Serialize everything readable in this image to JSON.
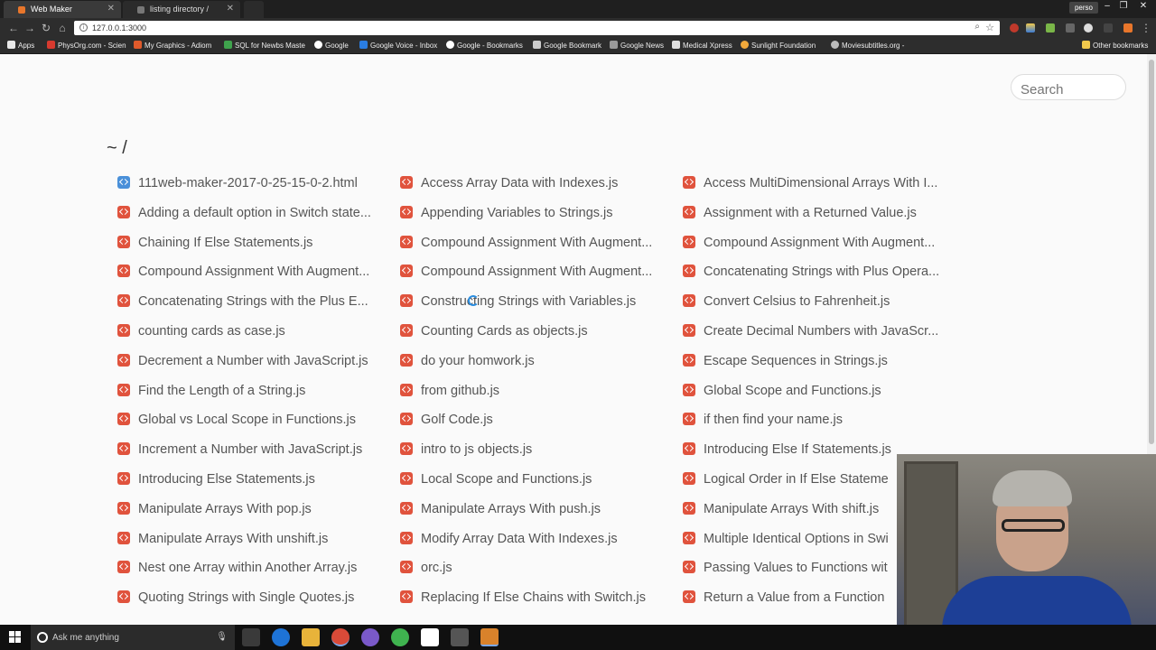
{
  "browser": {
    "tabs": [
      {
        "title": "Web Maker",
        "active": true
      },
      {
        "title": "listing directory /",
        "active": false
      }
    ],
    "profile": "perso",
    "url": "127.0.0.1:3000",
    "bookmarks": [
      {
        "label": "Apps",
        "color": "#e8e8e8"
      },
      {
        "label": "PhysOrg.com - Scien",
        "color": "#d73a2f"
      },
      {
        "label": "My Graphics - Adiom",
        "color": "#e05a2b"
      },
      {
        "label": "SQL for Newbs Maste",
        "color": "#3fa34d"
      },
      {
        "label": "Google",
        "color": "#ffffff"
      },
      {
        "label": "Google Voice - Inbox",
        "color": "#2a7de1"
      },
      {
        "label": "Google - Bookmarks",
        "color": "#ffffff"
      },
      {
        "label": "Google Bookmark",
        "color": "#cccccc"
      },
      {
        "label": "Google News",
        "color": "#9a9a9a"
      },
      {
        "label": "Medical Xpress",
        "color": "#e0e0e0"
      },
      {
        "label": "Sunlight Foundation",
        "color": "#f2a93b"
      },
      {
        "label": "Moviesubtitles.org - ",
        "color": "#bbbbbb"
      }
    ],
    "other_bookmarks": "Other bookmarks"
  },
  "page": {
    "search_placeholder": "Search",
    "path": "~ /",
    "files": [
      {
        "name": "111web-maker-2017-0-25-15-0-2.html",
        "kind": "html"
      },
      {
        "name": "Access Array Data with Indexes.js",
        "kind": "js"
      },
      {
        "name": "Access MultiDimensional Arrays With I...",
        "kind": "js"
      },
      {
        "name": "Adding a default option in Switch state...",
        "kind": "js"
      },
      {
        "name": "Appending Variables to Strings.js",
        "kind": "js"
      },
      {
        "name": "Assignment with a Returned Value.js",
        "kind": "js"
      },
      {
        "name": "Chaining If Else Statements.js",
        "kind": "js"
      },
      {
        "name": "Compound Assignment With Augment...",
        "kind": "js"
      },
      {
        "name": "Compound Assignment With Augment...",
        "kind": "js"
      },
      {
        "name": "Compound Assignment With Augment...",
        "kind": "js"
      },
      {
        "name": "Compound Assignment With Augment...",
        "kind": "js"
      },
      {
        "name": "Concatenating Strings with Plus Opera...",
        "kind": "js"
      },
      {
        "name": "Concatenating Strings with the Plus E...",
        "kind": "js"
      },
      {
        "name": "Constructing Strings with Variables.js",
        "kind": "js"
      },
      {
        "name": "Convert Celsius to Fahrenheit.js",
        "kind": "js"
      },
      {
        "name": "counting cards as case.js",
        "kind": "js"
      },
      {
        "name": "Counting Cards as objects.js",
        "kind": "js"
      },
      {
        "name": "Create Decimal Numbers with JavaScr...",
        "kind": "js"
      },
      {
        "name": "Decrement a Number with JavaScript.js",
        "kind": "js"
      },
      {
        "name": "do your homwork.js",
        "kind": "js"
      },
      {
        "name": "Escape Sequences in Strings.js",
        "kind": "js"
      },
      {
        "name": "Find the Length of a String.js",
        "kind": "js"
      },
      {
        "name": "from github.js",
        "kind": "js"
      },
      {
        "name": "Global Scope and Functions.js",
        "kind": "js"
      },
      {
        "name": "Global vs Local Scope in Functions.js",
        "kind": "js"
      },
      {
        "name": "Golf Code.js",
        "kind": "js"
      },
      {
        "name": "if then find your name.js",
        "kind": "js"
      },
      {
        "name": "Increment a Number with JavaScript.js",
        "kind": "js"
      },
      {
        "name": "intro to js objects.js",
        "kind": "js"
      },
      {
        "name": "Introducing Else If Statements.js",
        "kind": "js"
      },
      {
        "name": "Introducing Else Statements.js",
        "kind": "js"
      },
      {
        "name": "Local Scope and Functions.js",
        "kind": "js"
      },
      {
        "name": "Logical Order in If Else Stateme",
        "kind": "js"
      },
      {
        "name": "Manipulate Arrays With pop.js",
        "kind": "js"
      },
      {
        "name": "Manipulate Arrays With push.js",
        "kind": "js"
      },
      {
        "name": "Manipulate Arrays With shift.js",
        "kind": "js"
      },
      {
        "name": "Manipulate Arrays With unshift.js",
        "kind": "js"
      },
      {
        "name": "Modify Array Data With Indexes.js",
        "kind": "js"
      },
      {
        "name": "Multiple Identical Options in Swi",
        "kind": "js"
      },
      {
        "name": "Nest one Array within Another Array.js",
        "kind": "js"
      },
      {
        "name": "orc.js",
        "kind": "js"
      },
      {
        "name": "Passing Values to Functions wit",
        "kind": "js"
      },
      {
        "name": "Quoting Strings with Single Quotes.js",
        "kind": "js"
      },
      {
        "name": "Replacing If Else Chains with Switch.js",
        "kind": "js"
      },
      {
        "name": "Return a Value from a Function",
        "kind": "js"
      }
    ]
  },
  "taskbar": {
    "search_placeholder": "Ask me anything",
    "apps": [
      {
        "name": "task-view-icon",
        "color": "#3a3a3a",
        "active": false
      },
      {
        "name": "edge-icon",
        "color": "#1e73d6",
        "active": false
      },
      {
        "name": "file-explorer-icon",
        "color": "#e8b33a",
        "active": false
      },
      {
        "name": "chrome-icon",
        "color": "#d94a38",
        "active": true
      },
      {
        "name": "app-purple-icon",
        "color": "#7a59c9",
        "active": false
      },
      {
        "name": "app-green-icon",
        "color": "#3fb34f",
        "active": false
      },
      {
        "name": "skype-icon",
        "color": "#ffffff",
        "active": false
      },
      {
        "name": "app-dark-icon",
        "color": "#555555",
        "active": false
      },
      {
        "name": "app-orange-icon",
        "color": "#d9822b",
        "active": true
      }
    ]
  },
  "colors": {
    "js_icon": "#e0533d",
    "html_icon": "#4a90d9",
    "spinner": "#2a8de0"
  }
}
